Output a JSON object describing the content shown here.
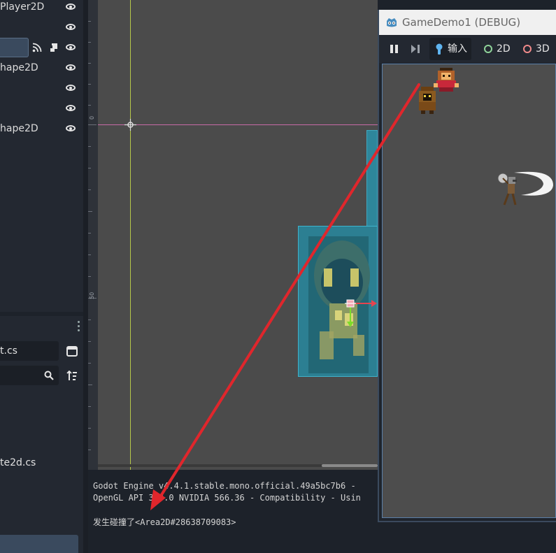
{
  "scene_tree": {
    "rows": [
      {
        "label": "Player2D"
      },
      {
        "label": ""
      },
      {
        "label": ""
      },
      {
        "label": "hape2D"
      },
      {
        "label": ""
      },
      {
        "label": ""
      },
      {
        "label": "hape2D"
      }
    ]
  },
  "filesystem": {
    "current_file": "t.cs",
    "list_items": [
      {
        "label": "te2d.cs"
      }
    ]
  },
  "viewport": {
    "ruler_labels": {
      "zero": "0",
      "fifty": "50"
    }
  },
  "console": {
    "lines": [
      "Godot Engine v4.4.1.stable.mono.official.49a5bc7b6 -",
      "OpenGL API 3.3.0 NVIDIA 566.36 - Compatibility - Usin",
      "",
      "发生碰撞了<Area2D#28638709083>"
    ]
  },
  "game_window": {
    "title": "GameDemo1 (DEBUG)",
    "toolbar": {
      "input_label": "输入",
      "label_2d": "2D",
      "label_3d": "3D"
    }
  },
  "colors": {
    "accent_blue": "#5b7fa8",
    "annotation_arrow": "#e0262c",
    "collision_shape": "#2aa9c4"
  }
}
